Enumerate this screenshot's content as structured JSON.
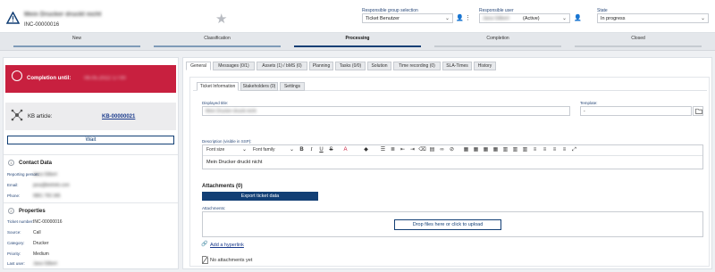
{
  "header": {
    "title": "Mein Drucker druckt nicht",
    "ticket_id": "INC-00000016",
    "group_label": "Responsible group selection",
    "group_value": "Ticket Benutzer",
    "user_label": "Responsible user",
    "user_name": "Jana Gilbert",
    "user_status": "(Active)",
    "state_label": "State",
    "state_value": "In progress"
  },
  "steps": [
    {
      "label": "New"
    },
    {
      "label": "Classification"
    },
    {
      "label": "Processing"
    },
    {
      "label": "Completion"
    },
    {
      "label": "Closed"
    }
  ],
  "sidebar": {
    "completion_label": "Completion until:",
    "completion_value": "06.05.2022 17:00",
    "kb_label": "KB article:",
    "kb_link": "KB-00000021",
    "wait_label": "Wait",
    "contact": {
      "heading": "Contact Data",
      "number": "1",
      "rows": [
        {
          "key": "Reporting person:",
          "value": "Jana Gilbert"
        },
        {
          "key": "Email:",
          "value": "jana@betrieb.com"
        },
        {
          "key": "Phone:",
          "value": "0861 765 345"
        }
      ]
    },
    "properties": {
      "heading": "Properties",
      "number": "2",
      "rows": [
        {
          "key": "Ticket number:",
          "value": "INC-00000016"
        },
        {
          "key": "Source:",
          "value": "Call"
        },
        {
          "key": "Category:",
          "value": "Drucker"
        },
        {
          "key": "Priority:",
          "value": "Medium"
        },
        {
          "key": "Last user:",
          "value": "Jana Gilbert"
        }
      ]
    }
  },
  "main": {
    "tabs": [
      "General",
      "Messages (0/1)",
      "Assets (1) / bMS (0)",
      "Planning",
      "Tasks (0/0)",
      "Solution",
      "Time recording (0)",
      "SLA-Times",
      "History"
    ],
    "subtabs": [
      "Ticket Information",
      "Stakeholders (0)",
      "Settings"
    ],
    "displayed_title_label": "Displayed title:",
    "displayed_title_value": "Mein Drucker druckt nicht",
    "template_label": "Template:",
    "template_value": "-",
    "description_label": "Description (visible in SSP):",
    "font_size": "Font size",
    "font_family": "Font family",
    "description_text": "Mein Drucker druckt nicht",
    "attachments_heading": "Attachments (0)",
    "export_button": "Export ticket data",
    "attachments_label": "Attachments:",
    "drop_text": "Drop files here or click to upload",
    "hyperlink_text": "Add a hyperlink",
    "no_attachments": "No attachments yet"
  },
  "colors": {
    "brand": "#123f75",
    "completion": "#c8203f",
    "progress": "#7f9bb8"
  }
}
